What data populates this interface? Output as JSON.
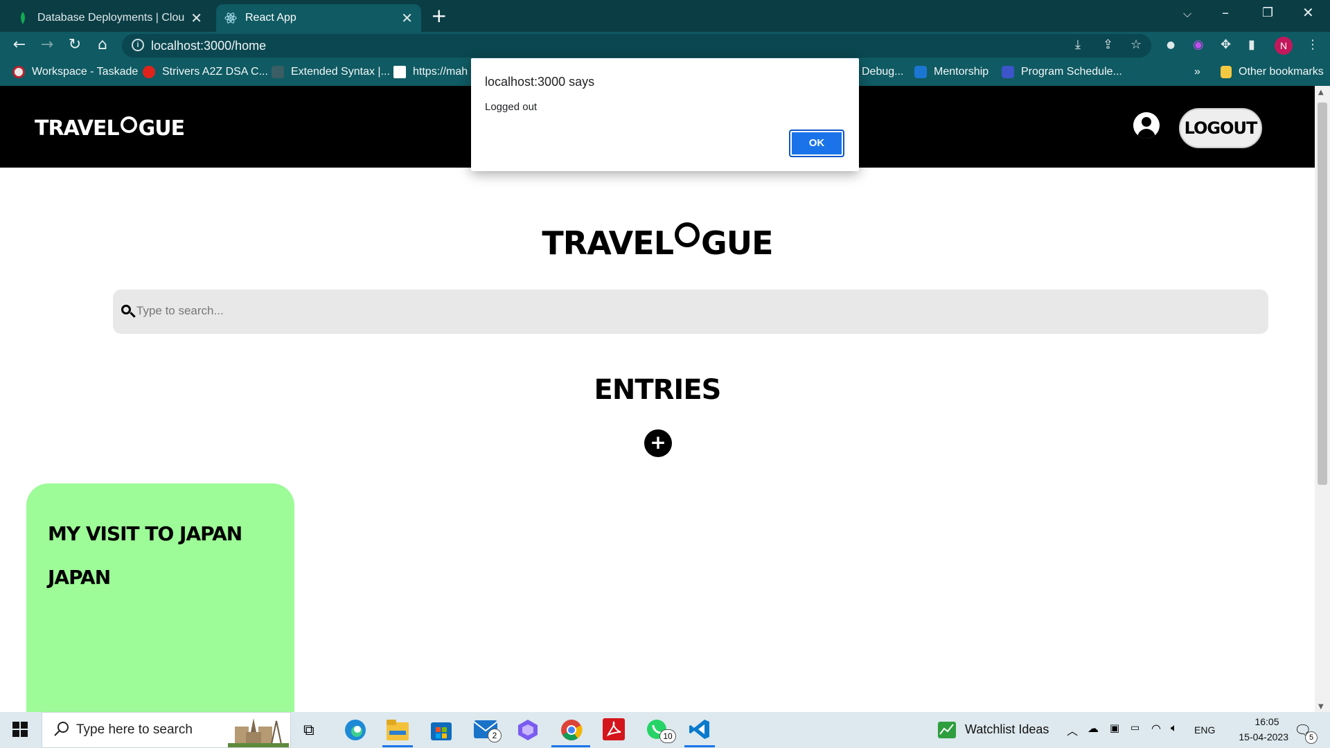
{
  "browser": {
    "tabs": [
      {
        "title": "Database Deployments | Cloud: M",
        "active": false,
        "icon": "mongodb-leaf-icon"
      },
      {
        "title": "React App",
        "active": true,
        "icon": "react-icon"
      }
    ],
    "url": "localhost:3000/home",
    "profile_initial": "N",
    "bookmarks": [
      {
        "label": "Workspace - Taskade"
      },
      {
        "label": "Strivers A2Z DSA C..."
      },
      {
        "label": "Extended Syntax |..."
      },
      {
        "label": "https://mah"
      },
      {
        "label": "Debug..."
      },
      {
        "label": "Mentorship"
      },
      {
        "label": "Program Schedule..."
      }
    ],
    "overflow": "»",
    "other_bookmarks": "Other bookmarks"
  },
  "app": {
    "brand_left": "TRAVEL",
    "brand_right": "GUE",
    "logout_label": "LOGOUT",
    "search_placeholder": "Type to search...",
    "entries_heading": "ENTRIES",
    "add_symbol": "+",
    "entries": [
      {
        "title": "MY VISIT TO JAPAN",
        "location": "JAPAN"
      }
    ]
  },
  "dialog": {
    "title": "localhost:3000 says",
    "message": "Logged out",
    "ok_label": "OK"
  },
  "taskbar": {
    "search_placeholder": "Type here to search",
    "mail_badge": "2",
    "whatsapp_badge": "10",
    "widget_label": "Watchlist Ideas",
    "language": "ENG",
    "time": "16:05",
    "date": "15-04-2023",
    "notification_count": "5"
  },
  "colors": {
    "chrome_tabstrip": "#0b3d45",
    "chrome_toolbar": "#0f5a63",
    "nav_bg": "#000000",
    "card_bg": "#9dfb98",
    "ok_button": "#1a73e8"
  }
}
